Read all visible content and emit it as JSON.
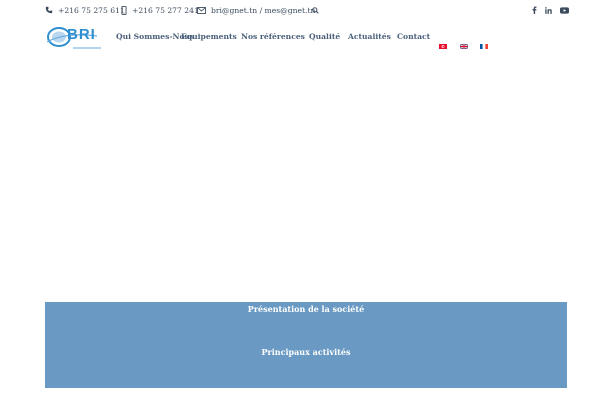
{
  "topbar": {
    "phone1": "+216 75 275 611",
    "phone2": "+216 75 277 241",
    "email": "bri@gnet.tn / mes@gnet.tn",
    "icons": [
      "phone-icon",
      "mobile-icon",
      "envelope-icon",
      "search-icon"
    ],
    "social": [
      "facebook-icon",
      "linkedin-icon",
      "youtube-icon"
    ]
  },
  "brand": {
    "logo_text": "BRI",
    "logo_color": "#2f8fd0"
  },
  "nav": {
    "items": [
      "Qui Sommes-Nous",
      "Equipements",
      "Nos références",
      "Qualité",
      "Actualités",
      "Contact"
    ],
    "flags": [
      "tunisia-flag",
      "uk-flag",
      "france-flag"
    ]
  },
  "panel": {
    "background": "#6a9ac3",
    "sections": [
      "Présentation de la société",
      "Principaux activités"
    ]
  }
}
